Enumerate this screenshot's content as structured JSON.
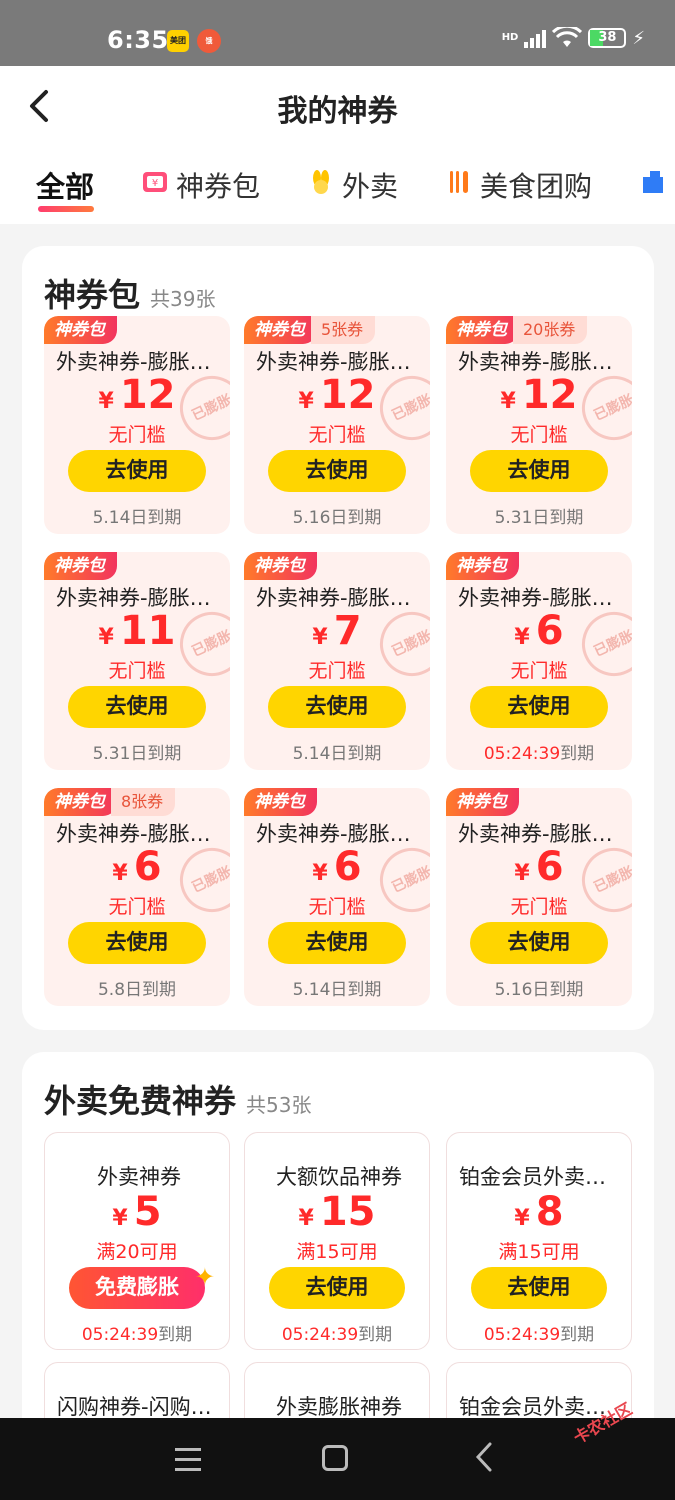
{
  "status_bar": {
    "time": "6:35",
    "app1": "美团",
    "app2": "饿",
    "hd": "HD",
    "battery": "38"
  },
  "header": {
    "title": "我的神券"
  },
  "tabs": [
    {
      "label": "全部",
      "icon": ""
    },
    {
      "label": "神券包",
      "icon": "coupon-pack-icon"
    },
    {
      "label": "外卖",
      "icon": "delivery-icon"
    },
    {
      "label": "美食团购",
      "icon": "food-icon"
    }
  ],
  "section1": {
    "title": "神券包",
    "count": "共39张",
    "badge": "神券包",
    "button": "去使用",
    "stamp": "已膨胀",
    "yen": "¥",
    "cards": [
      {
        "name": "外卖神券-膨胀神券",
        "amount": "12",
        "cond": "无门槛",
        "extra": "",
        "exp": "5.14日到期",
        "exp_hl": ""
      },
      {
        "name": "外卖神券-膨胀神券",
        "amount": "12",
        "cond": "无门槛",
        "extra": "5张券",
        "exp": "5.16日到期",
        "exp_hl": ""
      },
      {
        "name": "外卖神券-膨胀神券",
        "amount": "12",
        "cond": "无门槛",
        "extra": "20张券",
        "exp": "5.31日到期",
        "exp_hl": ""
      },
      {
        "name": "外卖神券-膨胀神券",
        "amount": "11",
        "cond": "无门槛",
        "extra": "",
        "exp": "5.31日到期",
        "exp_hl": ""
      },
      {
        "name": "外卖神券-膨胀神券",
        "amount": "7",
        "cond": "无门槛",
        "extra": "",
        "exp": "5.14日到期",
        "exp_hl": ""
      },
      {
        "name": "外卖神券-膨胀神券",
        "amount": "6",
        "cond": "无门槛",
        "extra": "",
        "exp": "到期",
        "exp_hl": "05:24:39"
      },
      {
        "name": "外卖神券-膨胀神券",
        "amount": "6",
        "cond": "无门槛",
        "extra": "8张券",
        "exp": "5.8日到期",
        "exp_hl": ""
      },
      {
        "name": "外卖神券-膨胀神券",
        "amount": "6",
        "cond": "无门槛",
        "extra": "",
        "exp": "5.14日到期",
        "exp_hl": ""
      },
      {
        "name": "外卖神券-膨胀神券",
        "amount": "6",
        "cond": "无门槛",
        "extra": "",
        "exp": "5.16日到期",
        "exp_hl": ""
      }
    ]
  },
  "section2": {
    "title": "外卖免费神券",
    "count": "共53张",
    "yen": "¥",
    "cards": [
      {
        "name": "外卖神券",
        "amount": "5",
        "cond": "满20可用",
        "button": "免费膨胀",
        "exp_hl": "05:24:39",
        "exp": "到期"
      },
      {
        "name": "大额饮品神券",
        "amount": "15",
        "cond": "满15可用",
        "button": "去使用",
        "exp_hl": "05:24:39",
        "exp": "到期"
      },
      {
        "name": "铂金会员外卖神券",
        "amount": "8",
        "cond": "满15可用",
        "button": "去使用",
        "exp_hl": "05:24:39",
        "exp": "到期"
      }
    ],
    "next_row": [
      "闪购神券-闪购专享",
      "外卖膨胀神券",
      "铂金会员外卖神券"
    ]
  },
  "watermark": "卡农社区"
}
